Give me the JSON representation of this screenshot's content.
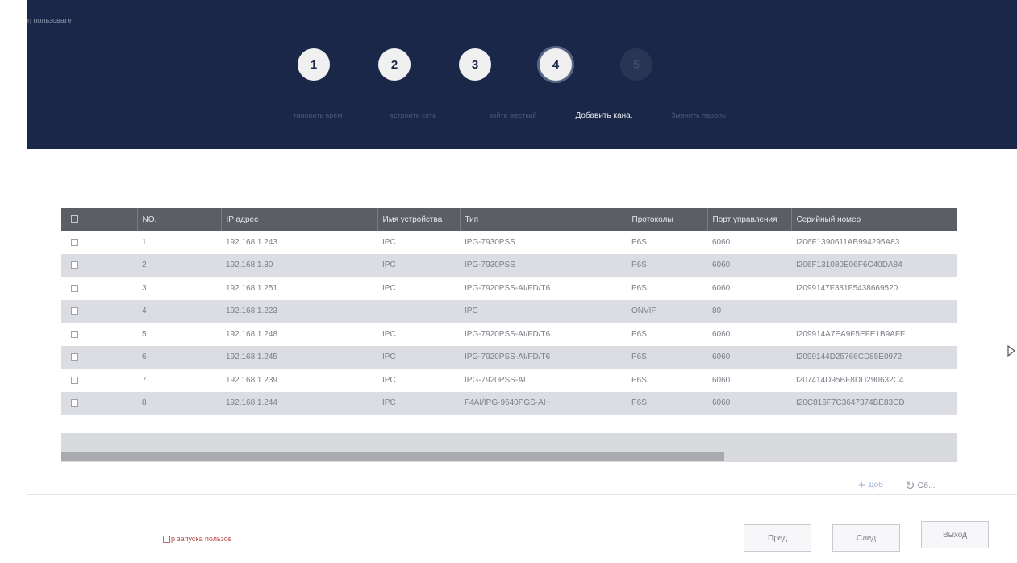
{
  "header": {
    "title": "η пользовате",
    "steps": [
      {
        "number": "1",
        "label": "тановить врем"
      },
      {
        "number": "2",
        "label": "астроить сеть"
      },
      {
        "number": "3",
        "label": "зойте жесткий"
      },
      {
        "number": "4",
        "label": "Добавить кана."
      },
      {
        "number": "5",
        "label": "Зменить пароль"
      }
    ]
  },
  "table": {
    "columns": [
      "NO.",
      "IP адрес",
      "Имя устройства",
      "Тип",
      "Протоколы",
      "Порт управления",
      "Серийный номер"
    ],
    "rows": [
      {
        "no": "1",
        "ip": "192.168.1.243",
        "name": "IPC",
        "type": "IPG-7930PSS",
        "protocol": "P6S",
        "port": "6060",
        "serial": "I206F1390611AB994295A83"
      },
      {
        "no": "2",
        "ip": "192.168.1.30",
        "name": "IPC",
        "type": "IPG-7930PSS",
        "protocol": "P6S",
        "port": "6060",
        "serial": "I206F131080E06F6C40DA84"
      },
      {
        "no": "3",
        "ip": "192.168.1.251",
        "name": "IPC",
        "type": "IPG-7920PSS-AI/FD/T6",
        "protocol": "P6S",
        "port": "6060",
        "serial": "I2099147F381F5438669520"
      },
      {
        "no": "4",
        "ip": "192.168.1.223",
        "name": "",
        "type": "IPC",
        "protocol": "ONVIF",
        "port": "80",
        "serial": ""
      },
      {
        "no": "5",
        "ip": "192.168.1.248",
        "name": "IPC",
        "type": "IPG-7920PSS-AI/FD/T6",
        "protocol": "P6S",
        "port": "6060",
        "serial": "I209914A7EA9F5EFE1B9AFF"
      },
      {
        "no": "6",
        "ip": "192.168.1.245",
        "name": "IPC",
        "type": "IPG-7920PSS-AI/FD/T6",
        "protocol": "P6S",
        "port": "6060",
        "serial": "I2099144D25766CD85E0972"
      },
      {
        "no": "7",
        "ip": "192.168.1.239",
        "name": "IPC",
        "type": "IPG-7920PSS-AI",
        "protocol": "P6S",
        "port": "6060",
        "serial": "I207414D95BF8DD290632C4"
      },
      {
        "no": "8",
        "ip": "192.168.1.244",
        "name": "IPC",
        "type": "F4AI/IPG-9640PGS-AI+",
        "protocol": "P6S",
        "port": "6060",
        "serial": "I20C816F7C3647374BE83CD"
      }
    ]
  },
  "actions": {
    "add_label": "Доб",
    "refresh_label": "Об..."
  },
  "footer": {
    "startup_label": "р запуска пользов",
    "prev_label": "Пред",
    "next_label": "След",
    "exit_label": "Выход"
  },
  "icons": [
    "checkbox-icon",
    "plus-icon",
    "refresh-icon",
    "cursor-icon"
  ]
}
